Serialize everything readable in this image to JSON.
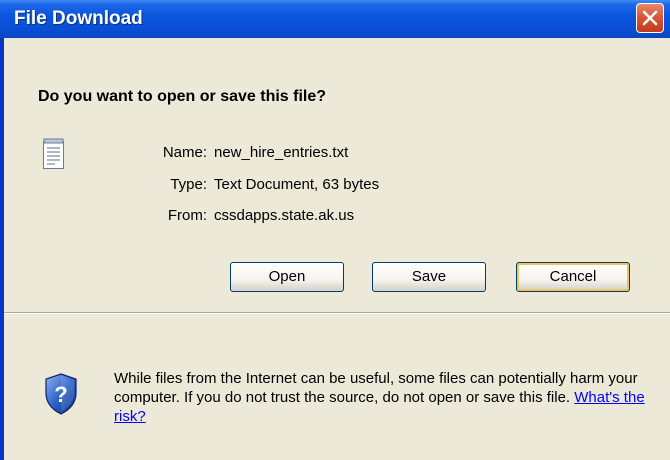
{
  "window": {
    "title": "File Download",
    "close_icon": "close-icon"
  },
  "dialog": {
    "question": "Do you want to open or save this file?",
    "file_icon": "text-document-icon",
    "fields": {
      "name_label": "Name:",
      "name_value": "new_hire_entries.txt",
      "type_label": "Type:",
      "type_value": "Text Document, 63 bytes",
      "from_label": "From:",
      "from_value": "cssdapps.state.ak.us"
    },
    "buttons": {
      "open_label": "Open",
      "save_label": "Save",
      "cancel_label": "Cancel"
    },
    "warning": {
      "icon": "security-shield-question-icon",
      "text": "While files from the Internet can be useful, some files can potentially harm your computer. If you do not trust the source, do not open or save this file.",
      "link_text": "What's the risk?"
    }
  },
  "colors": {
    "titlebar": "#0A4FD6",
    "dialog_background": "#ECE9D8",
    "close_button": "#D9573A",
    "link": "#0000FF"
  }
}
